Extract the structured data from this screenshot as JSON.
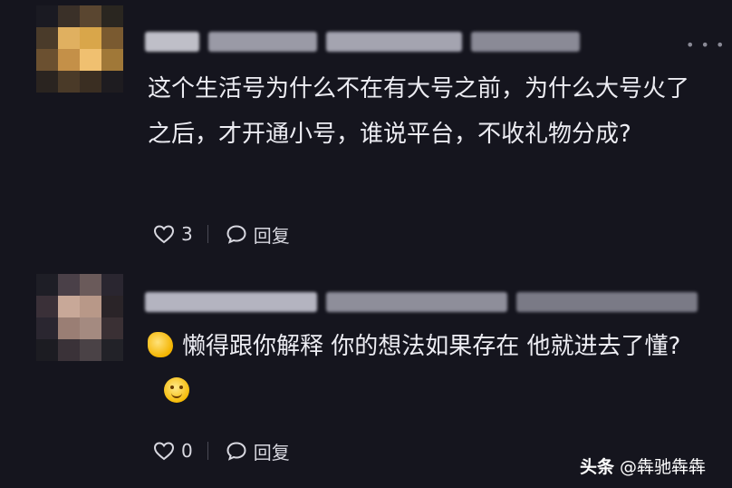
{
  "comments": [
    {
      "text": "这个生活号为什么不在有大号之前，为什么大号火了之后，才开通小号，谁说平台，不收礼物分成?",
      "likes": "3",
      "reply_label": "回复",
      "avatar_colors": [
        "#1a1a22",
        "#3a3028",
        "#5a4630",
        "#2a2620",
        "#4a3b2a",
        "#e0b060",
        "#d9a64a",
        "#7a5a30",
        "#6b5030",
        "#c49048",
        "#f0c070",
        "#a07838",
        "#2a2420",
        "#4a3a28",
        "#3a2e22",
        "#1e1c20"
      ],
      "name_blocks": [
        {
          "w": 60,
          "c": "#bfbfc8"
        },
        {
          "w": 120,
          "c": "#9a9aa6"
        },
        {
          "w": 150,
          "c": "#a4a4b0"
        },
        {
          "w": 120,
          "c": "#8a8a96"
        }
      ]
    },
    {
      "text": "懒得跟你解释 你的想法如果存在 他就进去了懂?",
      "likes": "0",
      "reply_label": "回复",
      "avatar_colors": [
        "#1e1e26",
        "#4a4048",
        "#6a5a5a",
        "#2a2630",
        "#3a3038",
        "#c8a898",
        "#b89888",
        "#2a2428",
        "#2a2630",
        "#9a7e74",
        "#a48a80",
        "#3a3034",
        "#1c1c22",
        "#3a3238",
        "#4a4246",
        "#222228"
      ],
      "name_blocks": [
        {
          "w": 190,
          "c": "#b4b4c0"
        },
        {
          "w": 200,
          "c": "#8e8e9a"
        },
        {
          "w": 200,
          "c": "#7a7a86"
        }
      ]
    }
  ],
  "more_icon": "more-dots-icon",
  "watermark": {
    "brand": "头条",
    "handle": "@犇驰犇犇"
  }
}
